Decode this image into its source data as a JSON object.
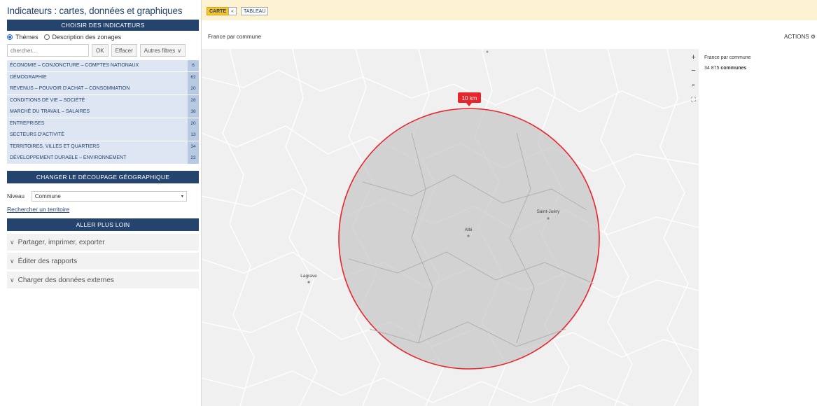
{
  "app": {
    "title": "Indicateurs : cartes, données et graphiques"
  },
  "sidebar": {
    "choose_title": "CHOISIR DES INDICATEURS",
    "radio": {
      "themes": "Thèmes",
      "zonages": "Description des zonages"
    },
    "search": {
      "placeholder": "chercher...",
      "ok": "OK",
      "clear": "Effacer",
      "filters": "Autres filtres"
    },
    "themes": [
      {
        "label": "ÉCONOMIE – CONJONCTURE – COMPTES NATIONAUX",
        "count": "6"
      },
      {
        "label": "DÉMOGRAPHIE",
        "count": "62"
      },
      {
        "label": "REVENUS – POUVOIR D'ACHAT – CONSOMMATION",
        "count": "20"
      },
      {
        "label": "CONDITIONS DE VIE – SOCIÉTÉ",
        "count": "28"
      },
      {
        "label": "MARCHÉ DU TRAVAIL – SALAIRES",
        "count": "38"
      },
      {
        "label": "ENTREPRISES",
        "count": "20"
      },
      {
        "label": "SECTEURS D'ACTIVITÉ",
        "count": "13"
      },
      {
        "label": "TERRITOIRES, VILLES ET QUARTIERS",
        "count": "34"
      },
      {
        "label": "DÉVELOPPEMENT DURABLE – ENVIRONNEMENT",
        "count": "22"
      }
    ],
    "geo_title": "CHANGER LE DÉCOUPAGE GÉOGRAPHIQUE",
    "niveau_label": "Niveau",
    "niveau_value": "Commune",
    "search_territory": "Rechercher un territoire",
    "more_title": "ALLER PLUS LOIN",
    "expand": [
      "Partager, imprimer, exporter",
      "Éditer des rapports",
      "Charger des données externes"
    ]
  },
  "tabs": {
    "carte": "CARTE",
    "tableau": "TABLEAU",
    "arrow": "«"
  },
  "map": {
    "title": "France par commune",
    "actions": "ACTIONS",
    "radius_label": "10 km",
    "places": {
      "albi": "Albi",
      "saint_juery": "Saint-Juéry",
      "lagrave": "Lagrave"
    }
  },
  "legend": {
    "title": "France par commune",
    "count": "34 875",
    "unit": "communes"
  },
  "colors": {
    "navy": "#24446e",
    "accent": "#f4c430",
    "circle": "#e8242c"
  },
  "icons": [
    "zoom-in-icon",
    "zoom-out-icon",
    "search-icon",
    "fullscreen-icon",
    "gear-icon",
    "chevron-down-icon"
  ]
}
